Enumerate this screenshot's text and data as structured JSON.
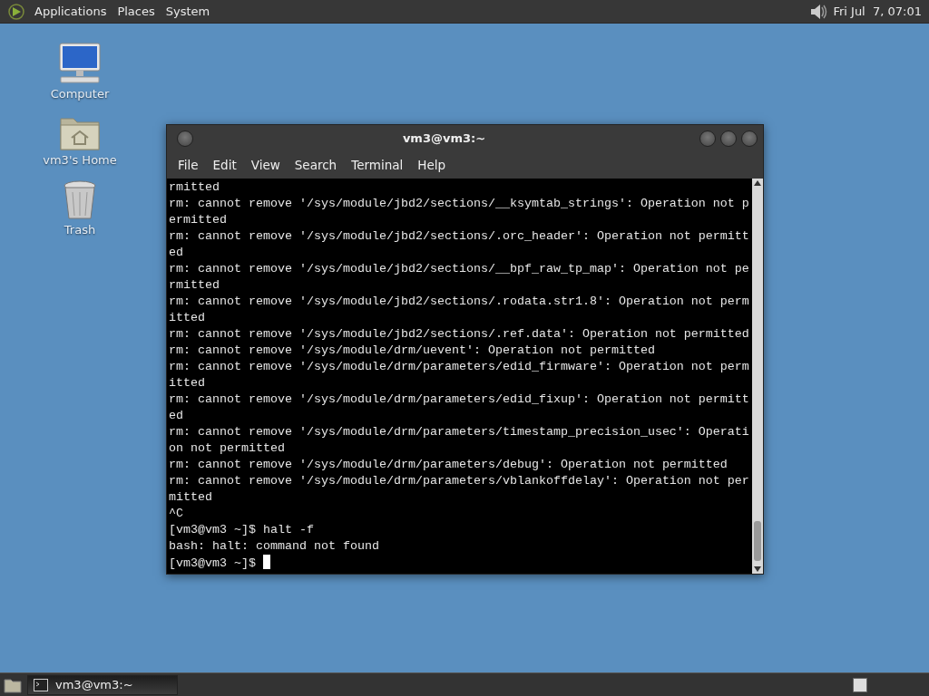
{
  "top_panel": {
    "menus": [
      "Applications",
      "Places",
      "System"
    ],
    "clock": "Fri Jul  7, 07:01"
  },
  "desktop_icons": [
    {
      "kind": "computer",
      "label": "Computer"
    },
    {
      "kind": "home",
      "label": "vm3's Home"
    },
    {
      "kind": "trash",
      "label": "Trash"
    }
  ],
  "window": {
    "title": "vm3@vm3:~",
    "menu": [
      "File",
      "Edit",
      "View",
      "Search",
      "Terminal",
      "Help"
    ],
    "lines": [
      "rmitted",
      "rm: cannot remove '/sys/module/jbd2/sections/__ksymtab_strings': Operation not p",
      "ermitted",
      "rm: cannot remove '/sys/module/jbd2/sections/.orc_header': Operation not permitt",
      "ed",
      "rm: cannot remove '/sys/module/jbd2/sections/__bpf_raw_tp_map': Operation not pe",
      "rmitted",
      "rm: cannot remove '/sys/module/jbd2/sections/.rodata.str1.8': Operation not perm",
      "itted",
      "rm: cannot remove '/sys/module/jbd2/sections/.ref.data': Operation not permitted",
      "rm: cannot remove '/sys/module/drm/uevent': Operation not permitted",
      "rm: cannot remove '/sys/module/drm/parameters/edid_firmware': Operation not perm",
      "itted",
      "rm: cannot remove '/sys/module/drm/parameters/edid_fixup': Operation not permitt",
      "ed",
      "rm: cannot remove '/sys/module/drm/parameters/timestamp_precision_usec': Operati",
      "on not permitted",
      "rm: cannot remove '/sys/module/drm/parameters/debug': Operation not permitted",
      "rm: cannot remove '/sys/module/drm/parameters/vblankoffdelay': Operation not per",
      "mitted",
      "^C",
      "[vm3@vm3 ~]$ halt -f",
      "bash: halt: command not found"
    ],
    "prompt": "[vm3@vm3 ~]$ "
  },
  "taskbar": {
    "tasks": [
      {
        "label": "vm3@vm3:~",
        "selected": true
      }
    ]
  }
}
